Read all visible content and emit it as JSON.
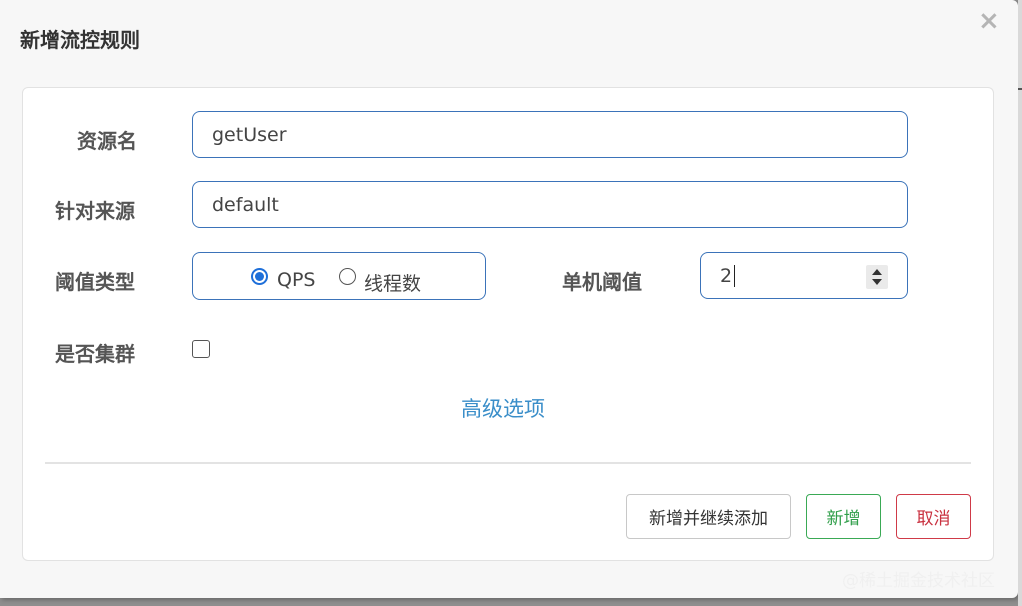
{
  "dialog": {
    "title": "新增流控规则",
    "close_glyph": "×"
  },
  "form": {
    "resource_name": {
      "label": "资源名",
      "value": "getUser"
    },
    "limit_app": {
      "label": "针对来源",
      "value": "default"
    },
    "grade": {
      "label": "阈值类型",
      "options": [
        {
          "label": "QPS",
          "checked": true
        },
        {
          "label": "线程数",
          "checked": false
        }
      ]
    },
    "count": {
      "label": "单机阈值",
      "value": "2"
    },
    "cluster": {
      "label": "是否集群",
      "checked": false
    },
    "advanced_link": "高级选项"
  },
  "footer": {
    "add_continue_label": "新增并继续添加",
    "add_label": "新增",
    "cancel_label": "取消"
  },
  "watermark": "@稀土掘金技术社区",
  "colors": {
    "input_border": "#3b73b9",
    "radio_checked": "#1e6fd9",
    "link": "#3a8ec9",
    "add_green": "#2f9e49",
    "cancel_red": "#c9303f"
  }
}
